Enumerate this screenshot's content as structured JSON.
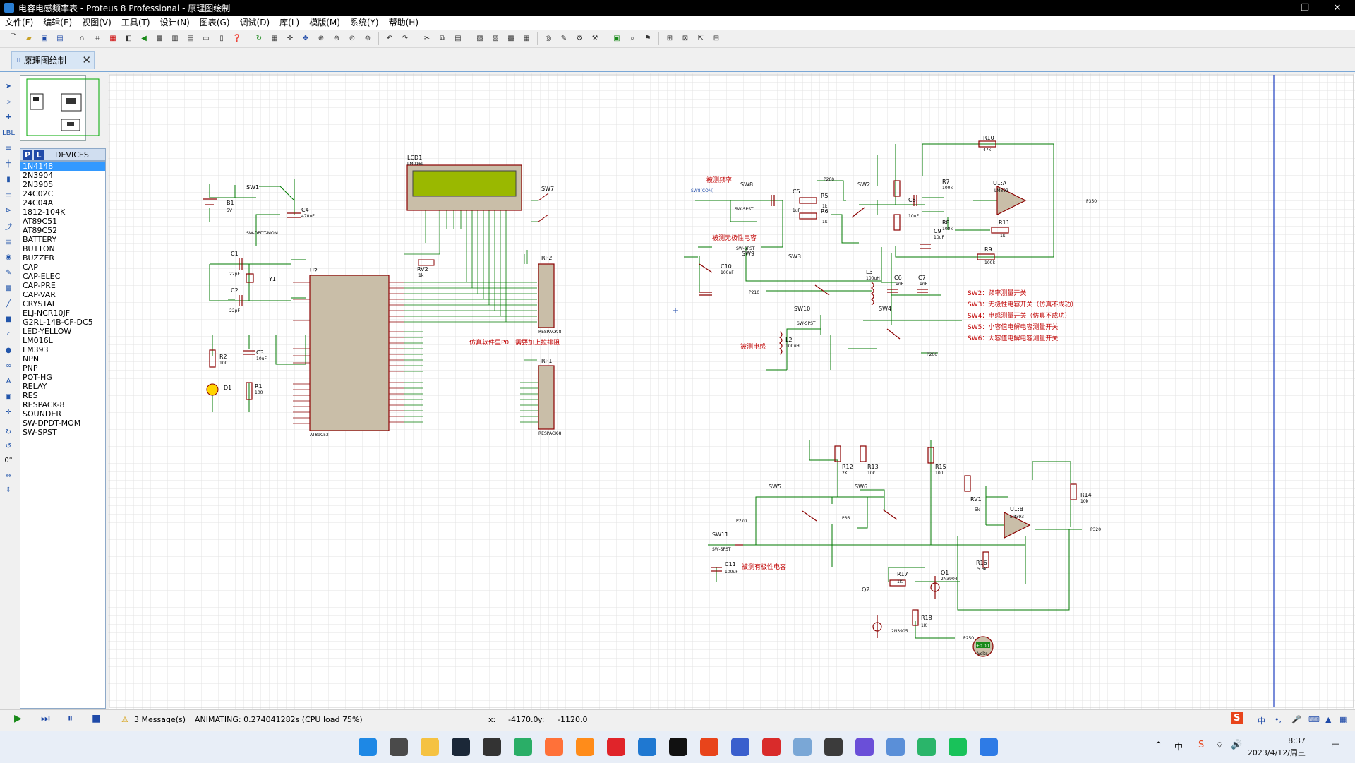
{
  "window": {
    "title": "电容电感频率表 - Proteus 8 Professional - 原理图绘制"
  },
  "menu": [
    "文件(F)",
    "编辑(E)",
    "视图(V)",
    "工具(T)",
    "设计(N)",
    "图表(G)",
    "调试(D)",
    "库(L)",
    "模版(M)",
    "系统(Y)",
    "帮助(H)"
  ],
  "tab": {
    "label": "原理图绘制"
  },
  "devices": {
    "header": "DEVICES",
    "items": [
      "1N4148",
      "2N3904",
      "2N3905",
      "24C02C",
      "24C04A",
      "1812-104K",
      "AT89C51",
      "AT89C52",
      "BATTERY",
      "BUTTON",
      "BUZZER",
      "CAP",
      "CAP-ELEC",
      "CAP-PRE",
      "CAP-VAR",
      "CRYSTAL",
      "ELJ-NCR10JF",
      "G2RL-14B-CF-DC5",
      "LED-YELLOW",
      "LM016L",
      "LM393",
      "NPN",
      "PNP",
      "POT-HG",
      "RELAY",
      "RES",
      "RESPACK-8",
      "SOUNDER",
      "SW-DPDT-MOM",
      "SW-SPST"
    ],
    "selected": "1N4148"
  },
  "rotation": "0°",
  "status": {
    "messages": "3 Message(s)",
    "animating": "ANIMATING: 0.274041282s (CPU load 75%)",
    "x_label": "x:",
    "x_value": "-4170.0",
    "y_label": "y:",
    "y_value": "-1120.0"
  },
  "clock": {
    "time": "8:37",
    "date": "2023/4/12/周三"
  },
  "schematic": {
    "notes": {
      "p0": "仿真软件里P0口需要加上拉排阻",
      "freq": "被测频率",
      "nonpolar": "被测无极性电容",
      "inductor": "被测电感",
      "polar": "被测有极性电容"
    },
    "legend": [
      "SW2：频率测量开关",
      "SW3：无极性电容开关（仿真不成功）",
      "SW4：电感测量开关（仿真不成功）",
      "SW5：小容值电解电容测量开关",
      "SW6：大容值电解电容测量开关"
    ],
    "labels": {
      "lcd1": "LCD1",
      "lm016l": "LM016L",
      "u2": "U2",
      "at89c52": "AT89C52",
      "rp1": "RP1",
      "rp2": "RP2",
      "respack8": "RESPACK-8",
      "sw1": "SW1",
      "swdpdt": "SW-DPDT-MOM",
      "sw7": "SW7",
      "b1": "B1",
      "b1v": "5V",
      "c1": "C1",
      "c2": "C2",
      "c1v": "22pF",
      "c2v": "22pF",
      "y1": "Y1",
      "c3": "C3",
      "c3v": "10uF",
      "c4": "C4",
      "c4v": "470uF",
      "r1": "R1",
      "r2": "R2",
      "r1v": "100",
      "r2v": "100",
      "d1": "D1",
      "rv2": "RV2",
      "rv2v": "1k",
      "sw8": "SW8",
      "sw9": "SW9",
      "sw2": "SW2",
      "sw3": "SW3",
      "sw4": "SW4",
      "sw10": "SW10",
      "swspst": "SW-SPST",
      "c5": "C5",
      "c5v": "1uF",
      "r5": "R5",
      "r6": "R6",
      "r5v": "1k",
      "r6v": "1k",
      "c8": "C8",
      "c8v": "10uF",
      "r7": "R7",
      "r8": "R8",
      "r7v": "100k",
      "r8v": "100k",
      "c9": "C9",
      "c9v": "10uF",
      "r10": "R10",
      "r10v": "47k",
      "u1a": "U1:A",
      "lm393": "LM393",
      "r11": "R11",
      "r11v": "1k",
      "r9": "R9",
      "r9v": "100k",
      "p350": "P350",
      "c10": "C10",
      "c10v": "100nF",
      "l3": "L3",
      "l3v": "100uH",
      "c6": "C6",
      "c7": "C7",
      "c6v": "1nF",
      "c7v": "1nF",
      "l2": "L2",
      "l2v": "100uH",
      "p210": "P210",
      "p260": "P260",
      "p200": "P200",
      "sw8com": "SW8(COM)",
      "r12": "R12",
      "r12v": "2K",
      "r13": "R13",
      "r13v": "10k",
      "r15": "R15",
      "r15v": "100",
      "sw5": "SW5",
      "sw6": "SW6",
      "sw11": "SW11",
      "c11": "C11",
      "c11v": "100uF",
      "rv1": "RV1",
      "rv1v": "5k",
      "u1b": "U1:B",
      "r14": "R14",
      "r14v": "10k",
      "p320": "P320",
      "r16": "R16",
      "r16v": "5.6k",
      "r17": "R17",
      "r17v": "1K",
      "q1": "Q1",
      "q1v": "2N3904",
      "q2": "Q2",
      "q2v": "2N3905",
      "r18": "R18",
      "r18v": "1K",
      "p250": "P250",
      "p270": "P270",
      "p36": "P36",
      "volts": "Volts",
      "vreading": "+0.00"
    }
  },
  "colors": {
    "accent": "#1f4aa8",
    "wire": "#007a00",
    "component": "#8b0000",
    "note": "#c00000",
    "grid": "#e3e3e3"
  }
}
